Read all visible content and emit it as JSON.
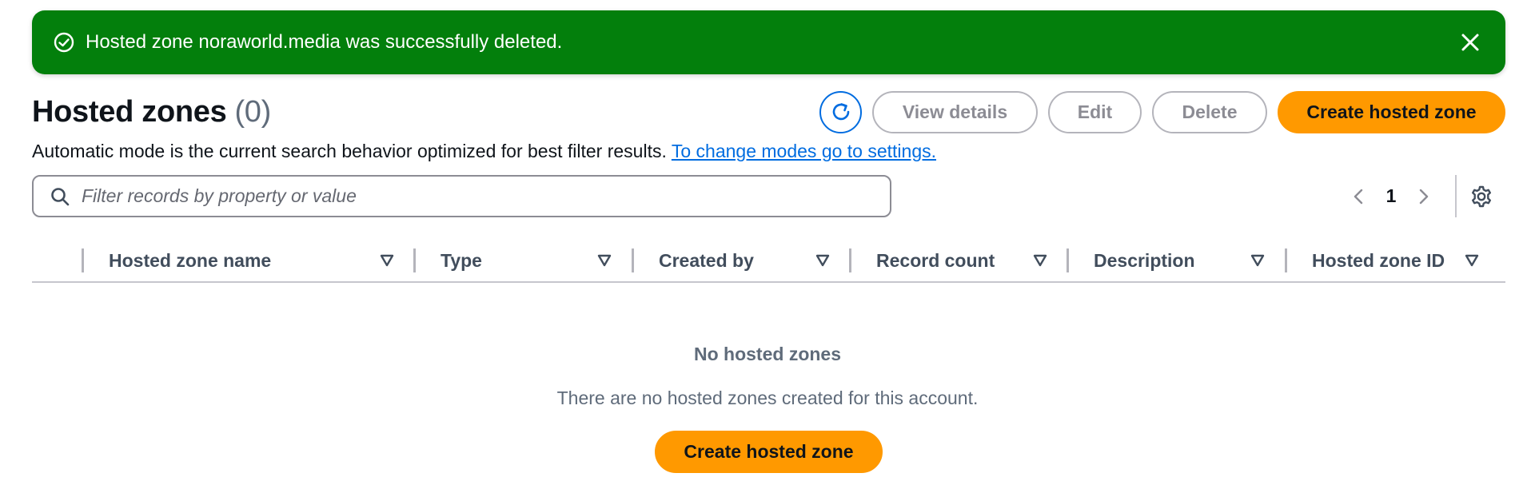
{
  "flash": {
    "message": "Hosted zone noraworld.media was successfully deleted.",
    "icon": "check-circle-icon",
    "close_icon": "close-icon",
    "color": "#037f0c"
  },
  "header": {
    "title": "Hosted zones",
    "count": "(0)",
    "refresh_icon": "refresh-icon",
    "buttons": {
      "view_details": "View details",
      "edit": "Edit",
      "delete": "Delete",
      "create": "Create hosted zone"
    },
    "accent": "#ff9900"
  },
  "subtext": {
    "text": "Automatic mode is the current search behavior optimized for best filter results.",
    "link": "To change modes go to settings."
  },
  "filter": {
    "placeholder": "Filter records by property or value",
    "value": ""
  },
  "pagination": {
    "current_page": "1",
    "prev_icon": "chevron-left-icon",
    "next_icon": "chevron-right-icon",
    "settings_icon": "gear-icon"
  },
  "table": {
    "columns": [
      {
        "label": "Hosted zone name"
      },
      {
        "label": "Type"
      },
      {
        "label": "Created by"
      },
      {
        "label": "Record count"
      },
      {
        "label": "Description"
      },
      {
        "label": "Hosted zone ID"
      }
    ],
    "rows": []
  },
  "empty_state": {
    "heading": "No hosted zones",
    "body": "There are no hosted zones created for this account.",
    "button": "Create hosted zone"
  }
}
